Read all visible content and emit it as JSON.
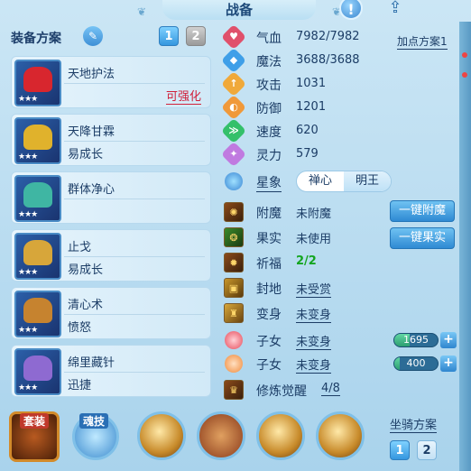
{
  "title": "战备",
  "alert_icon": "!",
  "left": {
    "heading": "装备方案",
    "tabs": [
      "1",
      "2"
    ],
    "equipment": [
      {
        "name": "天地护法",
        "sub": "",
        "tag": "可强化",
        "stars": "★★★",
        "art_color": "#d8262e"
      },
      {
        "name": "天降甘霖",
        "sub": "易成长",
        "tag": "",
        "stars": "★★★",
        "art_color": "#e0b22c"
      },
      {
        "name": "群体净心",
        "sub": "",
        "tag": "",
        "stars": "★★★",
        "art_color": "#3fb6a3"
      },
      {
        "name": "止戈",
        "sub": "易成长",
        "tag": "",
        "stars": "★★★",
        "art_color": "#d7a63a"
      },
      {
        "name": "清心术",
        "sub": "愤怒",
        "tag": "",
        "stars": "★★★",
        "art_color": "#c6832f"
      },
      {
        "name": "绵里藏针",
        "sub": "迅捷",
        "tag": "",
        "stars": "★★★",
        "art_color": "#8e6ad1"
      }
    ]
  },
  "stats": {
    "add_points": "加点方案1",
    "rows": [
      {
        "label": "气血",
        "value": "7982/7982",
        "color": "#e0506b",
        "icon": "♥"
      },
      {
        "label": "魔法",
        "value": "3688/3688",
        "color": "#3f9fe8",
        "icon": "◆"
      },
      {
        "label": "攻击",
        "value": "1031",
        "color": "#f0a93a",
        "icon": "↑"
      },
      {
        "label": "防御",
        "value": "1201",
        "color": "#f0993a",
        "icon": "◐"
      },
      {
        "label": "速度",
        "value": "620",
        "color": "#34c06a",
        "icon": "≫"
      },
      {
        "label": "灵力",
        "value": "579",
        "color": "#c07ae0",
        "icon": "✦"
      }
    ],
    "xingxiang": {
      "label": "星象",
      "options": [
        "禅心",
        "明王"
      ],
      "selected": "明王"
    }
  },
  "extras": [
    {
      "label": "附魔",
      "value": "未附魔",
      "style": "plain",
      "icon": "✺"
    },
    {
      "label": "果实",
      "value": "未使用",
      "style": "plain",
      "icon": "❂"
    },
    {
      "label": "祈福",
      "value": "2/2",
      "style": "green",
      "icon": "✹"
    },
    {
      "label": "封地",
      "value": "未受赏",
      "style": "underline",
      "icon": "▣"
    },
    {
      "label": "变身",
      "value": "未变身",
      "style": "underline",
      "icon": "♜"
    }
  ],
  "buttons": {
    "enchant": "一键附魔",
    "fruit": "一键果实"
  },
  "children": [
    {
      "label": "子女",
      "value": "未变身",
      "bar": "1695",
      "fill": 0.35,
      "color": "#e84a5a"
    },
    {
      "label": "子女",
      "value": "未变身",
      "bar": "400",
      "fill": 0.12,
      "color": "#f08a3a"
    }
  ],
  "refine": {
    "label": "修炼觉醒",
    "value": "4/8"
  },
  "bottom": {
    "set_label": "套装",
    "skill_label": "魂技",
    "mount_label": "坐骑方案",
    "mount_tabs": [
      "1",
      "2"
    ]
  }
}
